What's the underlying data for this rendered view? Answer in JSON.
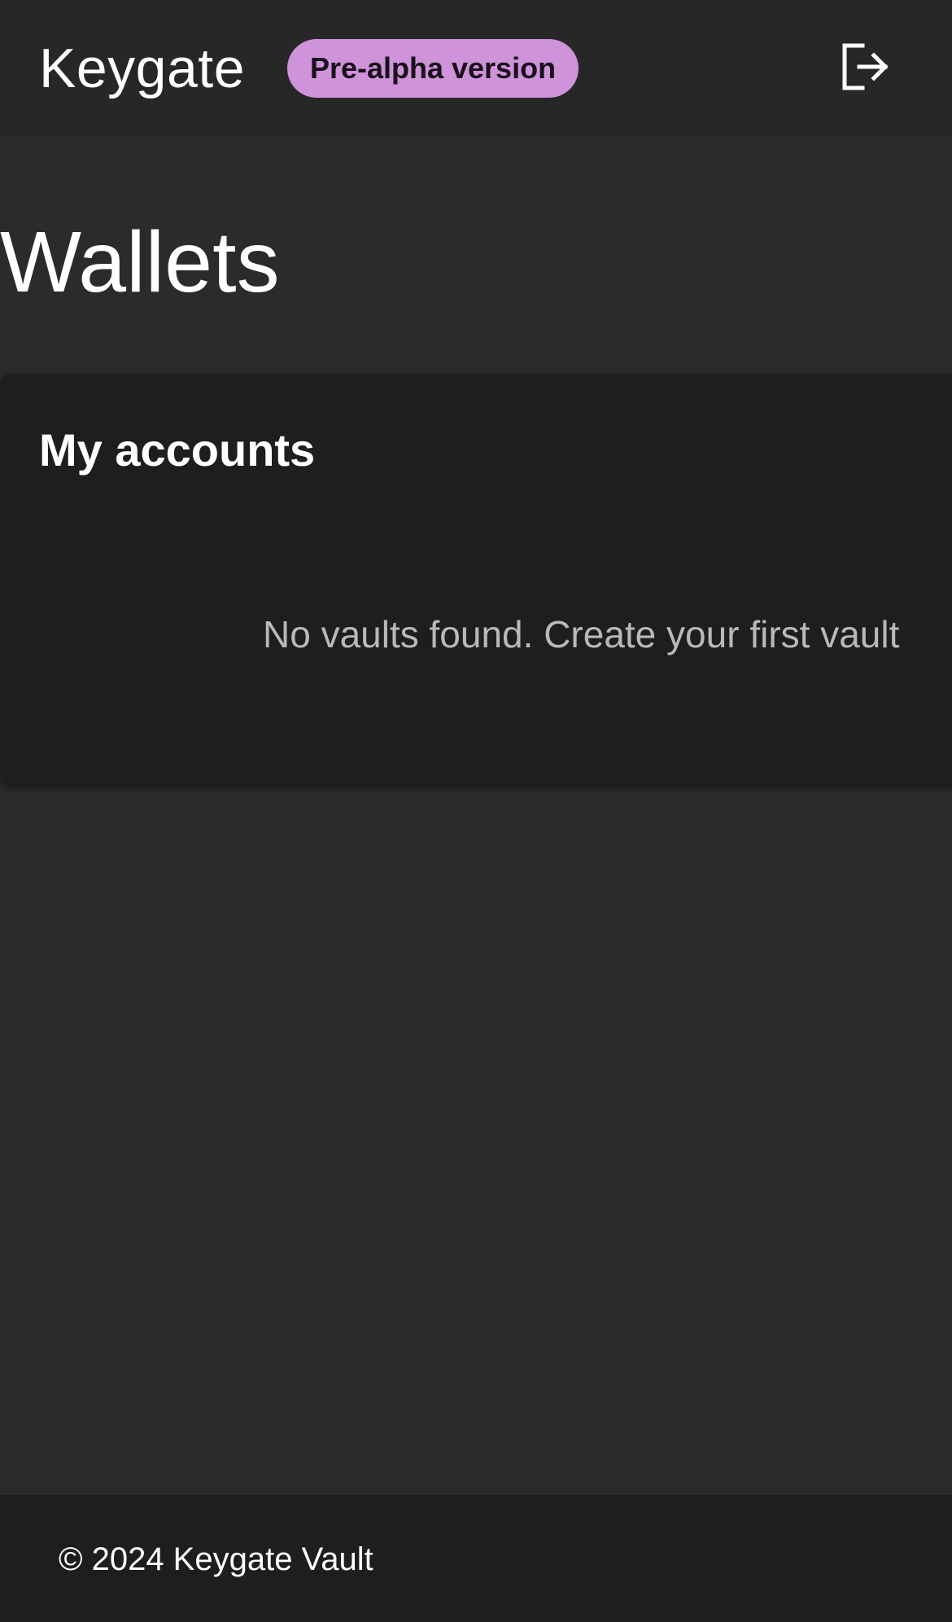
{
  "header": {
    "brand": "Keygate",
    "badge": "Pre-alpha version",
    "logout_icon": "logout-icon"
  },
  "main": {
    "title": "Wallets",
    "accounts_card": {
      "title": "My accounts",
      "empty_message": "No vaults found. Create your first vault"
    }
  },
  "footer": {
    "text": "© 2024 Keygate Vault"
  },
  "colors": {
    "page_background": "#2b2b2b",
    "header_background": "#272727",
    "card_background": "#1e1e1e",
    "badge_background": "#ce93d8",
    "badge_text": "#1a0e1c",
    "muted_text": "#b9b9b9"
  }
}
